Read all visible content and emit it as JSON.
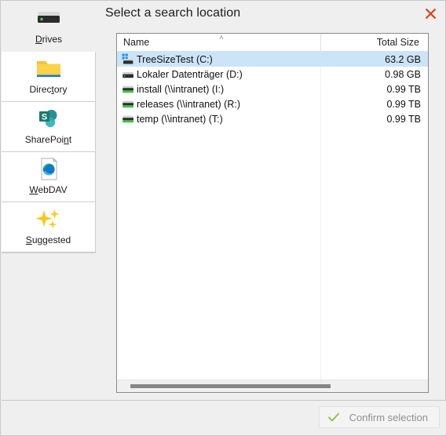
{
  "window": {
    "title": "Select a search location",
    "close_icon": "close-icon"
  },
  "sidebar": {
    "items": [
      {
        "label": "Drives",
        "accel": "D",
        "icon": "hard-drive-icon",
        "selected": true
      },
      {
        "label": "Directory",
        "accel": "t",
        "icon": "folder-icon",
        "selected": false
      },
      {
        "label": "SharePoint",
        "accel": "n",
        "icon": "sharepoint-icon",
        "selected": false
      },
      {
        "label": "WebDAV",
        "accel": "W",
        "icon": "webdav-edge-icon",
        "selected": false
      },
      {
        "label": "Suggested",
        "accel": "S",
        "icon": "sparkles-icon",
        "selected": false
      }
    ]
  },
  "list": {
    "columns": [
      {
        "key": "name",
        "label": "Name",
        "sort": "ascending"
      },
      {
        "key": "size",
        "label": "Total Size"
      }
    ],
    "sort_indicator": "˄",
    "rows": [
      {
        "name": "TreeSizeTest (C:)",
        "size": "63.2 GB",
        "icon": "windows-drive-icon",
        "selected": true
      },
      {
        "name": "Lokaler Datenträger (D:)",
        "size": "0.98 GB",
        "icon": "local-drive-icon",
        "selected": false
      },
      {
        "name": "install (\\\\intranet) (I:)",
        "size": "0.99 TB",
        "icon": "network-drive-icon",
        "selected": false
      },
      {
        "name": "releases (\\\\intranet) (R:)",
        "size": "0.99 TB",
        "icon": "network-drive-icon",
        "selected": false
      },
      {
        "name": "temp (\\\\intranet) (T:)",
        "size": "0.99 TB",
        "icon": "network-drive-icon",
        "selected": false
      }
    ],
    "horizontal_scrollbar": true
  },
  "footer": {
    "confirm_label": "Confirm selection",
    "confirm_icon": "check-icon",
    "confirm_disabled": true
  },
  "colors": {
    "selection": "#cce4f7",
    "close_x": "#d84315",
    "check_green": "#8bc34a",
    "window_bg": "#efefef",
    "list_bg": "#ffffff"
  }
}
